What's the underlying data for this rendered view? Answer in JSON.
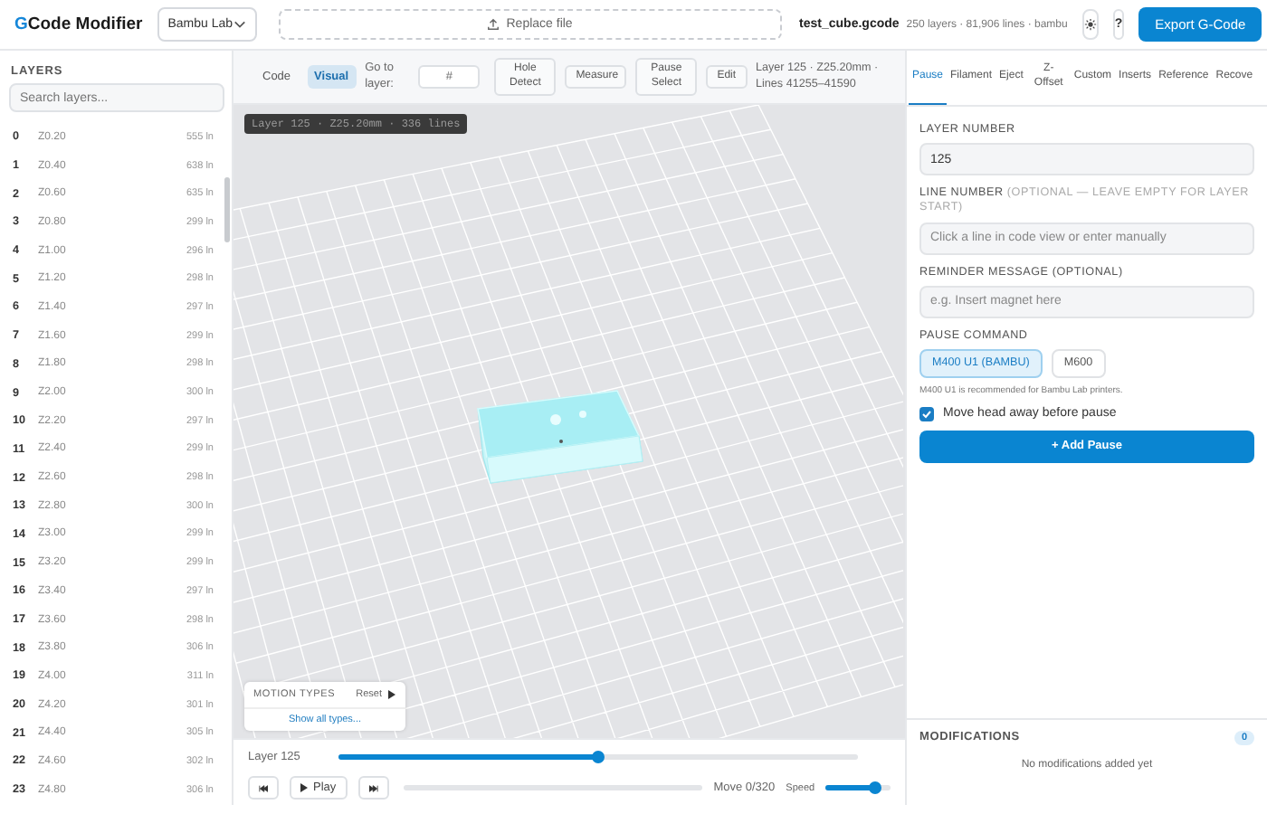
{
  "header": {
    "logo": {
      "accent": "G",
      "text": "Code Modifier"
    },
    "printer_select": {
      "value": "Bambu Lab"
    },
    "replace_file": "Replace file",
    "file": {
      "name": "test_cube.gcode",
      "meta": "250 layers · 81,906 lines · bambu"
    },
    "help": "?",
    "export": "Export G-Code"
  },
  "layers": {
    "title": "LAYERS",
    "search": {
      "placeholder": "Search layers..."
    },
    "items": [
      {
        "index": "0",
        "z": "Z0.20",
        "lines": "555 ln"
      },
      {
        "index": "1",
        "z": "Z0.40",
        "lines": "638 ln"
      },
      {
        "index": "2",
        "z": "Z0.60",
        "lines": "635 ln"
      },
      {
        "index": "3",
        "z": "Z0.80",
        "lines": "299 ln"
      },
      {
        "index": "4",
        "z": "Z1.00",
        "lines": "296 ln"
      },
      {
        "index": "5",
        "z": "Z1.20",
        "lines": "298 ln"
      },
      {
        "index": "6",
        "z": "Z1.40",
        "lines": "297 ln"
      },
      {
        "index": "7",
        "z": "Z1.60",
        "lines": "299 ln"
      },
      {
        "index": "8",
        "z": "Z1.80",
        "lines": "298 ln"
      },
      {
        "index": "9",
        "z": "Z2.00",
        "lines": "300 ln"
      },
      {
        "index": "10",
        "z": "Z2.20",
        "lines": "297 ln"
      },
      {
        "index": "11",
        "z": "Z2.40",
        "lines": "299 ln"
      },
      {
        "index": "12",
        "z": "Z2.60",
        "lines": "298 ln"
      },
      {
        "index": "13",
        "z": "Z2.80",
        "lines": "300 ln"
      },
      {
        "index": "14",
        "z": "Z3.00",
        "lines": "299 ln"
      },
      {
        "index": "15",
        "z": "Z3.20",
        "lines": "299 ln"
      },
      {
        "index": "16",
        "z": "Z3.40",
        "lines": "297 ln"
      },
      {
        "index": "17",
        "z": "Z3.60",
        "lines": "298 ln"
      },
      {
        "index": "18",
        "z": "Z3.80",
        "lines": "306 ln"
      },
      {
        "index": "19",
        "z": "Z4.00",
        "lines": "311 ln"
      },
      {
        "index": "20",
        "z": "Z4.20",
        "lines": "301 ln"
      },
      {
        "index": "21",
        "z": "Z4.40",
        "lines": "305 ln"
      },
      {
        "index": "22",
        "z": "Z4.60",
        "lines": "302 ln"
      },
      {
        "index": "23",
        "z": "Z4.80",
        "lines": "306 ln"
      }
    ]
  },
  "toolbar": {
    "view_modes": [
      {
        "label": "Code",
        "selected": false
      },
      {
        "label": "Visual",
        "selected": true
      }
    ],
    "goto": {
      "label": "Go to layer:",
      "placeholder": "#"
    },
    "tools": [
      "Hole Detect",
      "Measure",
      "Pause Select",
      "Edit"
    ],
    "info": "Layer 125 · Z25.20mm · Lines 41255–41590"
  },
  "viewer": {
    "overlay": "Layer 125 · Z25.20mm · 336 lines",
    "motion_types": {
      "title": "MOTION TYPES",
      "reset": "Reset",
      "show_all": "Show all types..."
    }
  },
  "playback": {
    "layer_label": "Layer 125",
    "layer_slider": {
      "level": 0.5
    },
    "play": "Play",
    "progress": {
      "level": 0
    },
    "move": "Move 0/320",
    "speed_label": "Speed",
    "speed": {
      "level": 0.75
    }
  },
  "panel": {
    "tabs": [
      {
        "label": "Pause",
        "selected": true
      },
      {
        "label": "Filament",
        "selected": false
      },
      {
        "label": "Eject",
        "selected": false
      },
      {
        "label": "Z-Offset",
        "selected": false
      },
      {
        "label": "Custom",
        "selected": false
      },
      {
        "label": "Inserts",
        "selected": false
      },
      {
        "label": "Reference",
        "selected": false
      },
      {
        "label": "Recove",
        "selected": false
      }
    ],
    "fields": [
      {
        "label": "LAYER NUMBER",
        "value": "125"
      },
      {
        "label": "LINE NUMBER",
        "hint": "(OPTIONAL — LEAVE EMPTY FOR LAYER START)",
        "placeholder": "Click a line in code view or enter manually"
      },
      {
        "label": "REMINDER MESSAGE (OPTIONAL)",
        "placeholder": "e.g. Insert magnet here"
      }
    ],
    "pause_command": {
      "label": "PAUSE COMMAND",
      "options": [
        {
          "label": "M400 U1 (BAMBU)",
          "selected": true
        },
        {
          "label": "M600",
          "selected": false
        }
      ],
      "note": "M400 U1 is recommended for Bambu Lab printers."
    },
    "move_head": {
      "label": "Move head away before pause",
      "checked": true
    },
    "add_button": "+ Add Pause",
    "modifications": {
      "title": "MODIFICATIONS",
      "count": "0",
      "empty": "No modifications added yet"
    }
  }
}
